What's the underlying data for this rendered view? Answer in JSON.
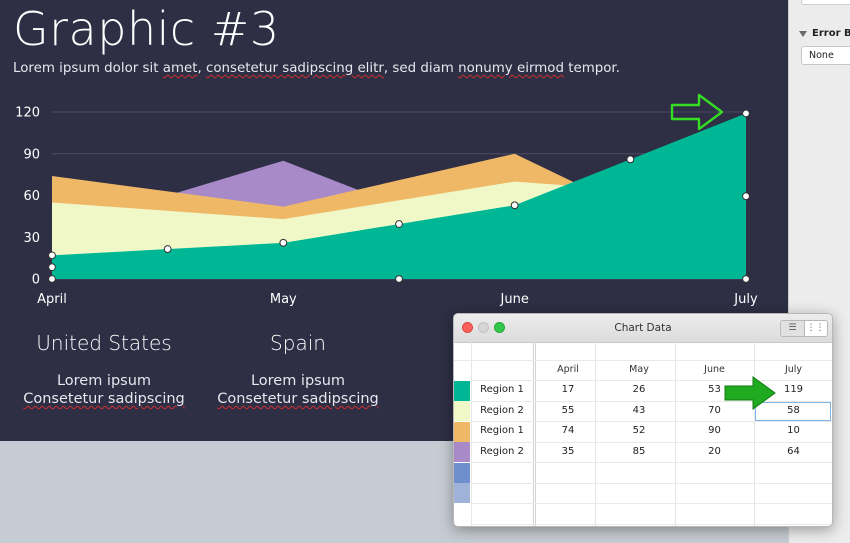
{
  "slide": {
    "title": "Graphic #3",
    "subtitle_parts": [
      {
        "text": "Lorem ipsum dolor sit ",
        "spell": false
      },
      {
        "text": "amet",
        "spell": true
      },
      {
        "text": ", ",
        "spell": false
      },
      {
        "text": "consetetur sadipscing elitr",
        "spell": true
      },
      {
        "text": ", sed diam ",
        "spell": false
      },
      {
        "text": "nonumy eirmod",
        "spell": true
      },
      {
        "text": " tempor.",
        "spell": false
      }
    ],
    "columns": [
      {
        "title": "United States",
        "line1": "Lorem ipsum",
        "line2": "Consetetur sadipscing"
      },
      {
        "title": "Spain",
        "line1": "Lorem ipsum",
        "line2": "Consetetur sadipscing"
      },
      {
        "title": "",
        "line1": "Lo",
        "line2": "Conse"
      }
    ]
  },
  "chart_data": {
    "type": "area",
    "categories": [
      "April",
      "May",
      "June",
      "July"
    ],
    "yticks": [
      0,
      30,
      60,
      90,
      120
    ],
    "ylim": [
      0,
      120
    ],
    "grid": true,
    "series": [
      {
        "name": "",
        "color": "#a88ac9",
        "values": [
          35,
          85,
          20,
          64
        ]
      },
      {
        "name": "",
        "color": "#efb867",
        "values": [
          74,
          52,
          90,
          10
        ]
      },
      {
        "name": "",
        "color": "#f1f8c8",
        "values": [
          55,
          43,
          70,
          58
        ]
      },
      {
        "name": "",
        "color": "#00b795",
        "values": [
          17,
          26,
          53,
          119
        ]
      }
    ],
    "arrow_color": "#35dd25"
  },
  "inspector": {
    "error_bars_label": "Error Ba",
    "error_bars_value": "None"
  },
  "chart_window": {
    "title": "Chart Data",
    "view_icons": [
      "list-view-icon",
      "column-view-icon"
    ],
    "columns": [
      "April",
      "May",
      "June",
      "July"
    ],
    "rows": [
      {
        "color": "#00b795",
        "label": "Region 1",
        "values": [
          "17",
          "26",
          "53",
          "119"
        ]
      },
      {
        "color": "#f1f8c8",
        "label": "Region 2",
        "values": [
          "55",
          "43",
          "70",
          "58"
        ]
      },
      {
        "color": "#efb867",
        "label": "Region 1",
        "values": [
          "74",
          "52",
          "90",
          "10"
        ]
      },
      {
        "color": "#a88ac9",
        "label": "Region 2",
        "values": [
          "35",
          "85",
          "20",
          "64"
        ]
      },
      {
        "color": "#6e8fcb",
        "label": "",
        "values": [
          "",
          "",
          "",
          ""
        ]
      },
      {
        "color": "#9fb2d8",
        "label": "",
        "values": [
          "",
          "",
          "",
          ""
        ]
      },
      {
        "color": "",
        "label": "",
        "values": [
          "",
          "",
          "",
          ""
        ]
      }
    ],
    "selected": {
      "row": 1,
      "col": 3
    },
    "arrow_color": "#1faa1f"
  }
}
